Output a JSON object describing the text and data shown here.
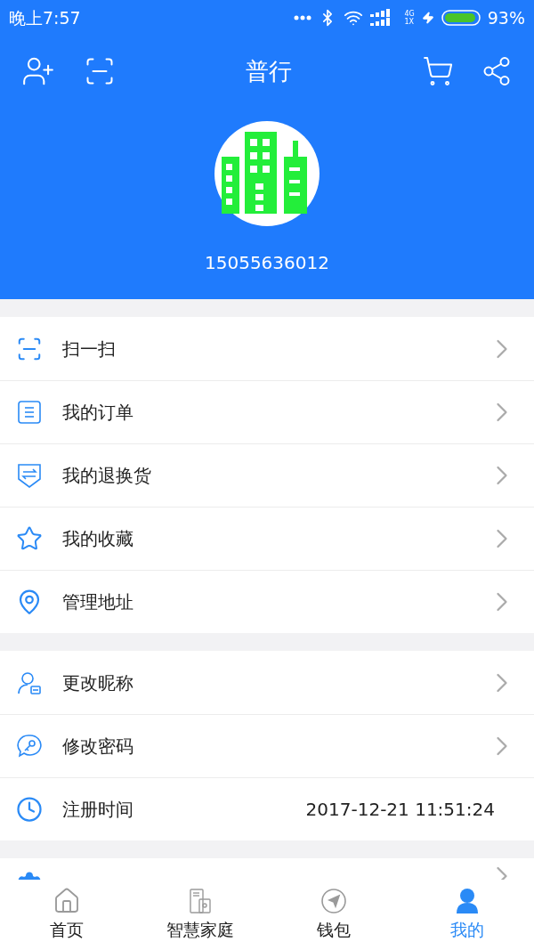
{
  "status_bar": {
    "time": "晚上7:57",
    "network": "4G",
    "network_sub": "1X",
    "battery": "93%"
  },
  "header": {
    "title": "普行",
    "account": "15055636012"
  },
  "menu_groups": [
    {
      "items": [
        {
          "kind": "scan",
          "label": "扫一扫",
          "chevron": true
        },
        {
          "kind": "order",
          "label": "我的订单",
          "chevron": true
        },
        {
          "kind": "return",
          "label": "我的退换货",
          "chevron": true
        },
        {
          "kind": "star",
          "label": "我的收藏",
          "chevron": true
        },
        {
          "kind": "location",
          "label": "管理地址",
          "chevron": true
        }
      ]
    },
    {
      "items": [
        {
          "kind": "user",
          "label": "更改昵称",
          "chevron": true
        },
        {
          "kind": "key",
          "label": "修改密码",
          "chevron": true
        },
        {
          "kind": "clock",
          "label": "注册时间",
          "value": "2017-12-21 11:51:24",
          "chevron": false
        }
      ]
    },
    {
      "items": [
        {
          "kind": "gear",
          "chevron": true
        }
      ]
    }
  ],
  "tab_bar": [
    {
      "kind": "home",
      "label": "首页",
      "selected": false
    },
    {
      "kind": "device",
      "label": "智慧家庭",
      "selected": false
    },
    {
      "kind": "compass",
      "label": "钱包",
      "selected": false
    },
    {
      "kind": "person",
      "label": "我的",
      "selected": true
    }
  ]
}
